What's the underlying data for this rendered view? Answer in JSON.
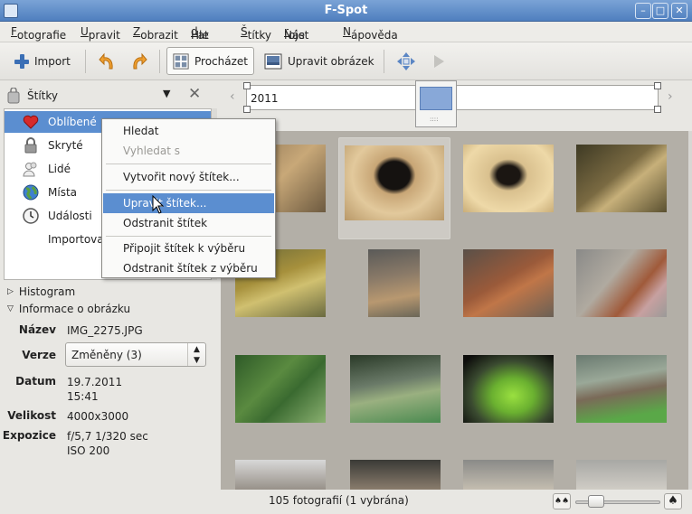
{
  "window": {
    "title": "F-Spot"
  },
  "menu": [
    {
      "pre": "",
      "acc": "F",
      "post": "otografie"
    },
    {
      "pre": "",
      "acc": "U",
      "post": "pravit"
    },
    {
      "pre": "",
      "acc": "Z",
      "post": "obrazit"
    },
    {
      "pre": "Hle",
      "acc": "d",
      "post": "at"
    },
    {
      "pre": "",
      "acc": "Š",
      "post": "títky"
    },
    {
      "pre": "Nást",
      "acc": "r",
      "post": "oje"
    },
    {
      "pre": "",
      "acc": "N",
      "post": "ápověda"
    }
  ],
  "toolbar": {
    "import_label": "Import",
    "browse_label": "Procházet",
    "edit_label": "Upravit obrázek"
  },
  "sidebar": {
    "tags_label": "Štítky",
    "tags": [
      {
        "label": "Oblíbené",
        "icon": "heart-icon"
      },
      {
        "label": "Skryté",
        "icon": "lock-icon"
      },
      {
        "label": "Lidé",
        "icon": "people-icon"
      },
      {
        "label": "Místa",
        "icon": "globe-icon"
      },
      {
        "label": "Události",
        "icon": "clock-icon"
      },
      {
        "label": "Importova",
        "icon": ""
      }
    ],
    "histogram_label": "Histogram",
    "info_label": "Informace o obrázku",
    "info": {
      "name_key": "Název",
      "name_val": "IMG_2275.JPG",
      "version_key": "Verze",
      "version_val": "Změněny (3)",
      "date_key": "Datum",
      "date_val": "19.7.2011",
      "time_val": "15:41",
      "size_key": "Velikost",
      "size_val": "4000x3000",
      "exposure_key": "Expozice",
      "exposure_val": "f/5,7 1/320 sec",
      "iso_val": "ISO 200"
    }
  },
  "timeline": {
    "year": "2011"
  },
  "context_menu": {
    "items": [
      {
        "label": "Hledat",
        "disabled": false
      },
      {
        "label": "Vyhledat s",
        "disabled": true
      },
      {
        "label": "Vytvořit nový štítek...",
        "disabled": false
      },
      {
        "label": "Upravit štítek...",
        "disabled": false,
        "highlighted": true
      },
      {
        "label": "Odstranit štítek",
        "disabled": false
      },
      {
        "label": "Připojit štítek k výběru",
        "disabled": false
      },
      {
        "label": "Odstranit štítek z výběru",
        "disabled": false
      }
    ]
  },
  "status": {
    "text": "105 fotografií (1 vybrána)"
  },
  "colors": {
    "accent": "#5b8ed0",
    "titlebar": "#5a88c6",
    "grid_bg": "#b3afa7"
  }
}
